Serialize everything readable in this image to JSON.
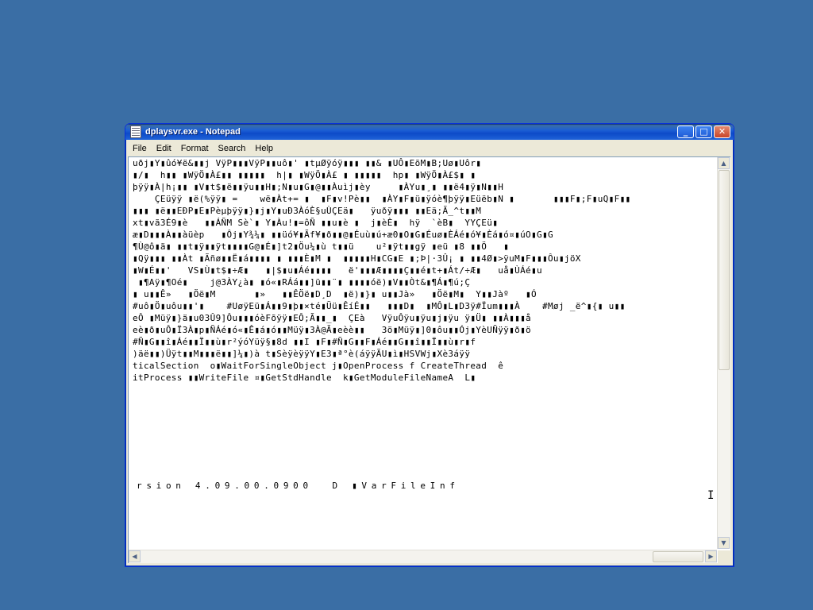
{
  "window": {
    "title": "dplaysvr.exe - Notepad",
    "close_glyph": "✕",
    "maximize_glyph": "□",
    "minimize_glyph": "_"
  },
  "menu": [
    "File",
    "Edit",
    "Format",
    "Search",
    "Help"
  ],
  "content": {
    "lines": [
      "uðj▮Y▮ûó¥ë&▮▮j VÿP▮▮▮VÿP▮▮uô▮' ▮tµØÿóÿ▮▮▮ ▮▮& ▮UÔ▮EõM▮B;Uø▮Uôr▮",
      "▮/▮  h▮▮ ▮WÿÖ▮À£▮▮ ▮▮▮▮▮  h|▮ ▮WÿÖ▮À£ ▮ ▮▮▮▮▮  hp▮ ▮WÿÖ▮À£$▮ ▮",
      "þÿÿ▮À|h¡▮▮ ▮V▮t$▮ë▮▮ÿu▮▮H▮;N▮u▮G▮@▮▮Àuìj▮èy     ▮ÀYu▮¸▮ ▮▮ë4▮ÿ▮N▮▮H",
      "    ÇEüÿÿ ▮ë(%ÿÿ▮ =    wë▮Àt+= ▮  ▮F▮v!Pè▮▮  ▮ÀY▮F▮ü▮ÿóè¶þÿÿ▮Eüëb▮N ▮       ▮▮▮F▮;F▮uQ▮F▮▮",
      "▮▮▮ ▮ë▮▮EÐP▮E▮Pèµþÿÿ▮}▮j▮Y▮uÐ3ÀóÈ§uÙÇEä▮   ÿuðÿ▮▮▮ ▮▮Eä;Ã_^t▮▮M",
      "xt▮vã3É9▮è   ▮▮ÁÑM Sè`▮ Y▮Àu!▮=ôÑ ▮▮u▮è ▮  j▮èÈ▮  hÿ  `èB▮  YYÇEü▮",
      "æ▮D▮▮▮À▮▮àüèp   ▮Ôj▮Y¾¼▮ ▮▮üó¥▮Ãf¥▮ð▮▮@▮Éuù▮ú+æ0▮O▮G▮Éuø▮ÈÁé▮ó¥▮Èá▮ó¤▮úO▮G▮G",
      "¶Ù@ô▮ä▮ ▮▮t▮ÿ▮▮ÿt▮▮▮▮G@▮É▮]t2▮Öu¼▮ù t▮▮ü    u²▮ÿt▮▮gÿ ▮eü ▮8 ▮▮Ö   ▮",
      "▮Qÿ▮▮▮ ▮▮Àt ▮Ãñø▮▮Ë▮á▮▮▮▮ ▮ ▮▮▮È▮M ▮  ▮▮▮▮▮H▮CG▮E ▮;Þ|·3Û¡ ▮ ▮▮4Ø▮>ÿuM▮F▮▮▮Ôu▮jöX",
      "▮W▮É▮▮'   VS▮Ù▮t$▮÷Æ▮   ▮|$▮u▮Áé▮▮▮▮   ë'▮▮▮Æ▮▮▮▮Ç▮▮é▮t+▮Át/÷Æ▮   uå▮ÙÁé▮u",
      " ▮¶Aÿ▮¶Oé▮    j@3ÀY¿à▮ ▮ó«▮RÁá▮▮]ü▮▮¨▮ ▮▮▮▮óë)▮V▮▮Òt&▮¶Á▮¶ú;Ç",
      "▮ u▮▮Ê»   ▮Öë▮M       ▮»   ▮▮ÊÖë▮D¸D  ▮ë)▮}▮ u▮▮Jà»   ▮Öë▮M▮  Y▮▮Jàº   ▮Ó",
      "#uô▮Ö▮uôu▮▮'▮    #UøÿEü▮Á▮▮9▮þ▮×té▮Üü▮ÊíÉ▮▮   ▮▮▮D▮  ▮MÔ▮L▮D3ÿ#Ïum▮▮▮À    #Møj _ë^▮{▮ u▮▮",
      "eÔ ▮Müÿ▮}ä▮u03Û9]Ôu▮▮▮óèFõÿÿ▮EÔ;Ã▮▮_▮  ÇEà   VÿuÔÿu▮ÿu▮j▮ÿu ÿ▮Ü▮ ▮▮À▮▮▮å",
      "eè▮ð▮uÔ▮Ï3À▮p▮ÑÁé▮ó«▮Ê▮á▮ó▮▮Müÿ▮3À@Ã▮eèè▮▮   3ö▮Müÿ▮]0▮ôu▮▮Ój▮YèUÑÿÿ▮ð▮ö",
      "#Ñ▮G▮▮î▮Áé▮▮Ï▮▮ù▮r²ýóYüÿ§▮8d ▮▮I ▮F▮#Ñ▮G▮▮F▮Áé▮▮G▮▮î▮▮Ï▮▮ù▮r▮f",
      ")äë▮▮)Üÿt▮▮M▮▮▮ë▮▮]¼▮)à t▮SèÿèÿÿY▮E3▮ª°è(áÿÿÃU▮ì▮HSVWj▮Xè3áÿÿ",
      "ticalSection  o▮WaitForSingleObject j▮OpenProcess f CreateThread  ê",
      "itProcess ▮▮WriteFile ¤▮GetStdHandle  k▮GetModuleFileNameA  L▮"
    ],
    "spaced_line": "rsion 4.09.00.0900  D ▮VarFileInf"
  },
  "scrollbar": {
    "up_arrow": "▲",
    "down_arrow": "▼",
    "left_arrow": "◀",
    "right_arrow": "▶"
  },
  "cursor_glyph": "I"
}
